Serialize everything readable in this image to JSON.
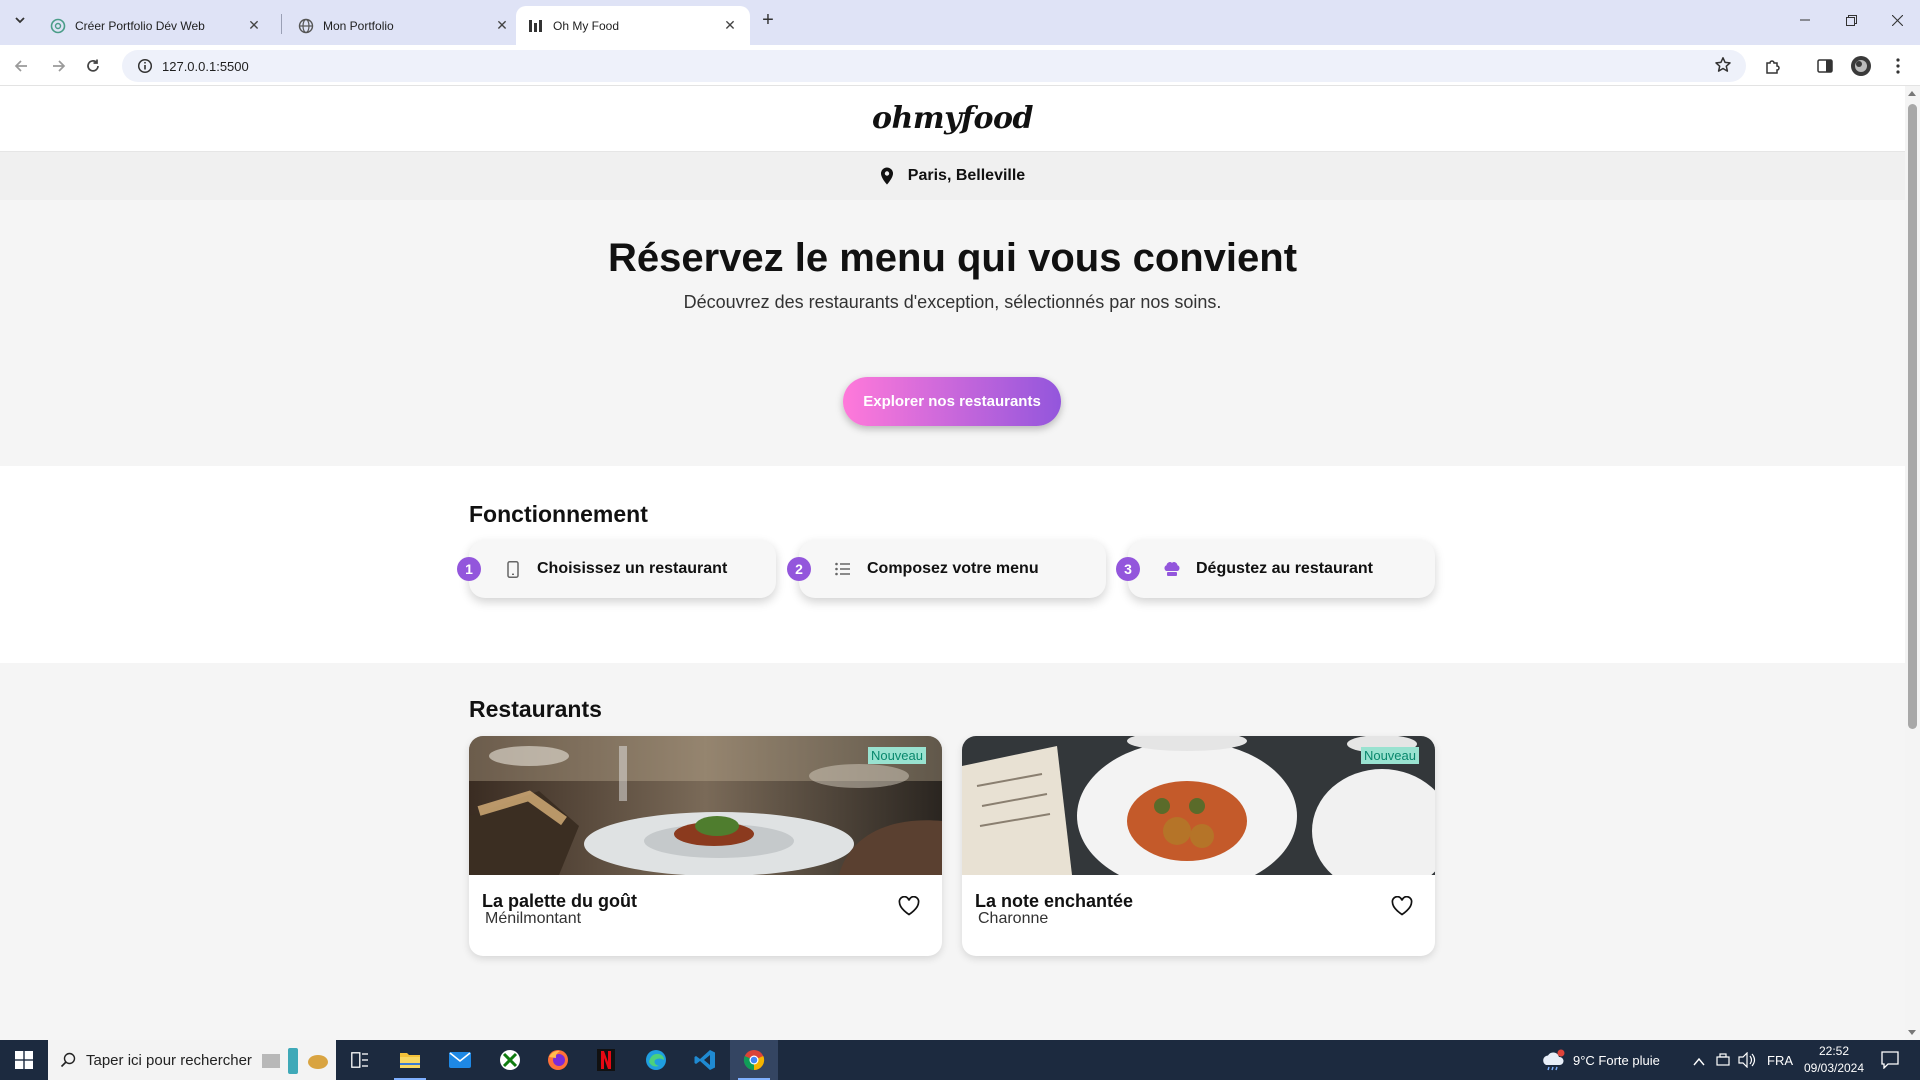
{
  "browser": {
    "tabs": [
      {
        "title": "Créer Portfolio Dév Web",
        "active": false
      },
      {
        "title": "Mon Portfolio",
        "active": false
      },
      {
        "title": "Oh My Food",
        "active": true
      }
    ],
    "url": "127.0.0.1:5500"
  },
  "page": {
    "logo": "ohmyfood",
    "location": "Paris, Belleville",
    "hero": {
      "title": "Réservez le menu qui vous convient",
      "subtitle": "Découvrez des restaurants d'exception, sélectionnés par nos soins.",
      "cta": "Explorer nos restaurants"
    },
    "howto": {
      "title": "Fonctionnement",
      "steps": [
        {
          "number": "1",
          "label": "Choisissez un restaurant",
          "icon": "mobile-phone-icon"
        },
        {
          "number": "2",
          "label": "Composez votre menu",
          "icon": "list-icon"
        },
        {
          "number": "3",
          "label": "Dégustez au restaurant",
          "icon": "chef-hat-icon"
        }
      ]
    },
    "restaurants": {
      "title": "Restaurants",
      "cards": [
        {
          "name": "La palette du goût",
          "district": "Ménilmontant",
          "badge": "Nouveau"
        },
        {
          "name": "La note enchantée",
          "district": "Charonne",
          "badge": "Nouveau"
        }
      ]
    }
  },
  "taskbar": {
    "search_placeholder": "Taper ici pour rechercher",
    "weather": "9°C  Forte pluie",
    "language": "FRA",
    "time": "22:52",
    "date": "09/03/2024"
  },
  "colors": {
    "accent_start": "#ff79da",
    "accent_end": "#9356dc",
    "badge_bg": "#99e2d0",
    "badge_text": "#08876c"
  }
}
